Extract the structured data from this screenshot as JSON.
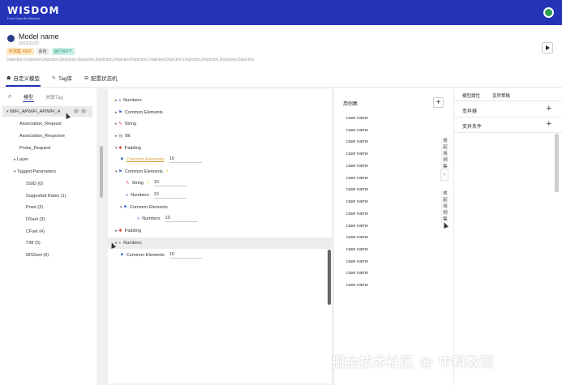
{
  "topbar": {
    "logo_main": "WISDOM",
    "logo_sub": "Fuzz Easy By Wisdom"
  },
  "header": {
    "model_name": "Model name",
    "date": "2023/11/13",
    "tags": [
      "所测集 #903",
      "系统",
      "运行中2个"
    ],
    "depiction": "Depiction,DepictionDepiction,Depiction,Depiction,Depiction,DepictionDepiction,DepictionDepiction,Depiction,Depiction,Depiction,Depiction"
  },
  "main_tabs": [
    "自定义模型",
    "Tag库",
    "配置状态机"
  ],
  "left_panel": {
    "tabs": [
      "模型",
      "关联Tag"
    ],
    "tree": [
      {
        "label": "WIFI_APWIFI_APWIFI_A",
        "level": 0,
        "caret": "▾"
      },
      {
        "label": "Association_Request",
        "level": 2,
        "caret": ""
      },
      {
        "label": "Association_Response",
        "level": 2,
        "caret": ""
      },
      {
        "label": "Probe_Request",
        "level": 2,
        "caret": ""
      },
      {
        "label": "Layer",
        "level": 1,
        "caret": "▸"
      },
      {
        "label": "Tagged Parameters",
        "level": 1,
        "caret": "▾"
      },
      {
        "label": "SSID (0)",
        "level": 3,
        "caret": ""
      },
      {
        "label": "Supported Rates (1)",
        "level": 3,
        "caret": ""
      },
      {
        "label": "Prset (2)",
        "level": 3,
        "caret": ""
      },
      {
        "label": "DSset (3)",
        "level": 3,
        "caret": ""
      },
      {
        "label": "CFset (4)",
        "level": 3,
        "caret": ""
      },
      {
        "label": "TIM (5)",
        "level": 3,
        "caret": ""
      },
      {
        "label": "IBSSset (6)",
        "level": 3,
        "caret": ""
      }
    ]
  },
  "center_tree": [
    {
      "label": "Numbers",
      "indent": 0,
      "caret": "▸",
      "icon": "≡",
      "icon_color": "blue",
      "value": ""
    },
    {
      "label": "Common Elements",
      "indent": 0,
      "caret": "▸",
      "icon": "⚑",
      "icon_color": "blue",
      "value": ""
    },
    {
      "label": "String",
      "indent": 0,
      "caret": "▸",
      "icon": "✎",
      "icon_color": "red",
      "value": ""
    },
    {
      "label": "Bit",
      "indent": 0,
      "caret": "▸",
      "icon": "▤",
      "icon_color": "gray",
      "value": ""
    },
    {
      "label": "Padding",
      "indent": 0,
      "caret": "▾",
      "icon": "✱",
      "icon_color": "red",
      "value": ""
    },
    {
      "label": "Common Elements",
      "indent": 1,
      "caret": "",
      "icon": "⚑",
      "icon_color": "blue",
      "value": "10",
      "link": true
    },
    {
      "label": "Common Elements",
      "indent": 0,
      "caret": "▾",
      "icon": "⚑",
      "icon_color": "blue",
      "value": "",
      "bolt": true
    },
    {
      "label": "String",
      "indent": 1,
      "caret": "",
      "icon": "✎",
      "icon_color": "red",
      "value": "10",
      "bolt": true
    },
    {
      "label": "Numbers",
      "indent": 1,
      "caret": "",
      "icon": "≡",
      "icon_color": "blue",
      "value": "10"
    },
    {
      "label": "Common Elements",
      "indent": 1,
      "caret": "▾",
      "icon": "⚑",
      "icon_color": "blue",
      "value": ""
    },
    {
      "label": "Numbers",
      "indent": 2,
      "caret": "",
      "icon": "≡",
      "icon_color": "blue",
      "value": "10"
    },
    {
      "label": "Padding",
      "indent": 0,
      "caret": "▸",
      "icon": "✱",
      "icon_color": "red",
      "value": ""
    },
    {
      "label": "Numbers",
      "indent": 0,
      "caret": "▸",
      "icon": "≡",
      "icon_color": "green",
      "value": "",
      "highlight": true
    },
    {
      "label": "Common Elements",
      "indent": 0,
      "caret": "",
      "icon": "⚑",
      "icon_color": "blue",
      "value": "10"
    }
  ],
  "case_panel": {
    "title": "用例集",
    "add_label": "+",
    "cases": [
      "case name",
      "case name",
      "case name",
      "case name",
      "case name",
      "case name",
      "case name",
      "case name",
      "case name",
      "case name",
      "case name",
      "case name",
      "case name",
      "case name",
      "case name"
    ],
    "vtab1": [
      "收",
      "起",
      "用",
      "例",
      "集"
    ],
    "vtab2": [
      "收",
      "起",
      "用",
      "例",
      "集"
    ],
    "chevron": "›"
  },
  "right_panel": {
    "tabs": [
      "模型属性",
      "变异策略"
    ],
    "rows": [
      {
        "label": "变异器",
        "plus": "+"
      },
      {
        "label": "变异条件",
        "plus": "+"
      }
    ]
  },
  "watermark": "掘金技术社区 @ 中科数测",
  "colors": {
    "brand_blue": "#2433b8",
    "tag_orange": "#d07a00",
    "tag_teal": "#1a8a70",
    "bolt": "#f0b400",
    "link_orange": "#d89e3a"
  },
  "icons": {
    "search": "search-icon",
    "play": "play-icon",
    "user_avatar": "user-avatar-icon",
    "model": "model-icon"
  }
}
